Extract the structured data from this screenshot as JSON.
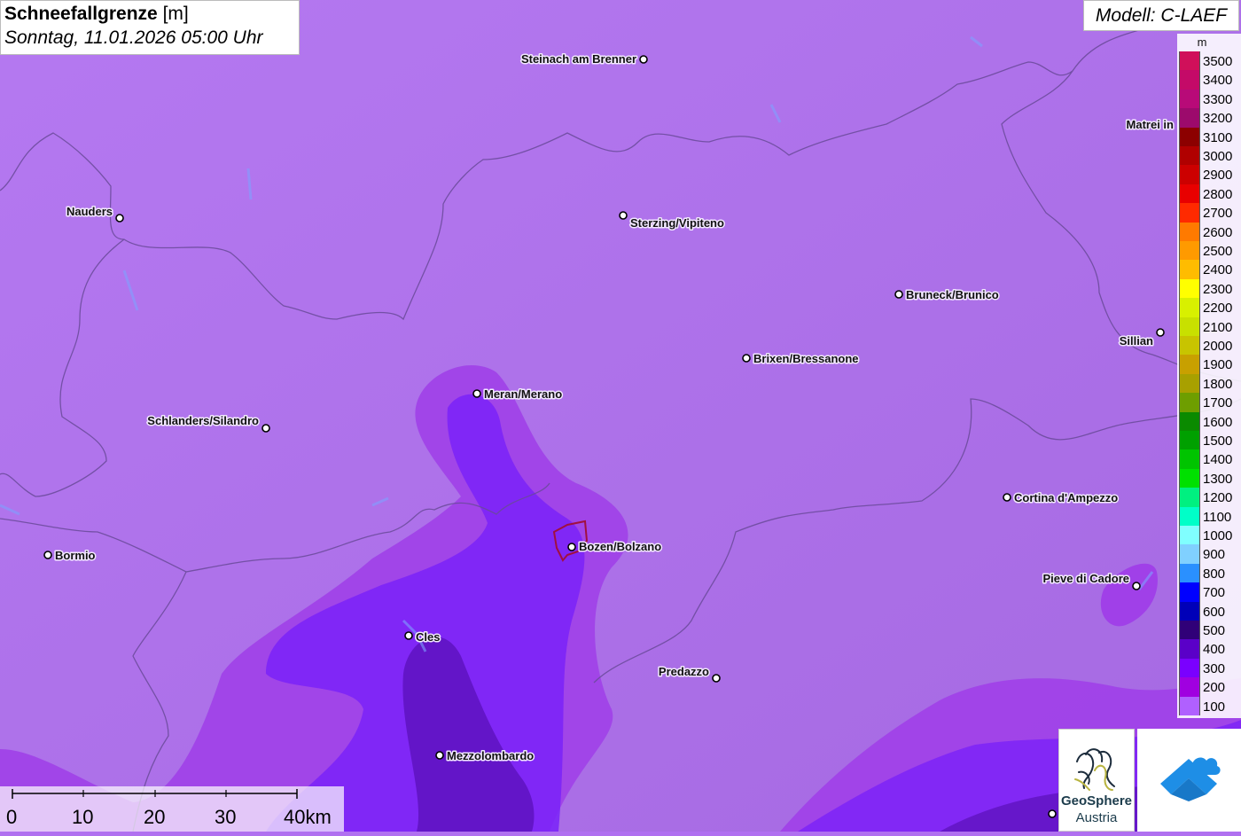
{
  "title": {
    "main": "Schneefallgrenze",
    "unit": "[m]",
    "datetime": "Sonntag, 11.01.2026 05:00 Uhr"
  },
  "model": "Modell: C-LAEF",
  "legend": {
    "unit": "m",
    "entries": [
      {
        "value": "3500",
        "color": "#d0105a"
      },
      {
        "value": "3400",
        "color": "#c40a68"
      },
      {
        "value": "3300",
        "color": "#b80a78"
      },
      {
        "value": "3200",
        "color": "#9c0a6c"
      },
      {
        "value": "3100",
        "color": "#8c0000"
      },
      {
        "value": "3000",
        "color": "#b00000"
      },
      {
        "value": "2900",
        "color": "#cc0000"
      },
      {
        "value": "2800",
        "color": "#e80000"
      },
      {
        "value": "2700",
        "color": "#ff2a00"
      },
      {
        "value": "2600",
        "color": "#ff7a00"
      },
      {
        "value": "2500",
        "color": "#ff9a00"
      },
      {
        "value": "2400",
        "color": "#ffbc00"
      },
      {
        "value": "2300",
        "color": "#ffff00"
      },
      {
        "value": "2200",
        "color": "#d8f000"
      },
      {
        "value": "2100",
        "color": "#c8e000"
      },
      {
        "value": "2000",
        "color": "#c8c400"
      },
      {
        "value": "1900",
        "color": "#c8a000"
      },
      {
        "value": "1800",
        "color": "#a8a000"
      },
      {
        "value": "1700",
        "color": "#6e9e00"
      },
      {
        "value": "1600",
        "color": "#0a8a00"
      },
      {
        "value": "1500",
        "color": "#00a000"
      },
      {
        "value": "1400",
        "color": "#00c400"
      },
      {
        "value": "1300",
        "color": "#00e000"
      },
      {
        "value": "1200",
        "color": "#00f080"
      },
      {
        "value": "1100",
        "color": "#00ffc8"
      },
      {
        "value": "1000",
        "color": "#80ffff"
      },
      {
        "value": "900",
        "color": "#80d0ff"
      },
      {
        "value": "800",
        "color": "#2a90ff"
      },
      {
        "value": "700",
        "color": "#0000ff"
      },
      {
        "value": "600",
        "color": "#0000b8"
      },
      {
        "value": "500",
        "color": "#300078"
      },
      {
        "value": "400",
        "color": "#5a00c8"
      },
      {
        "value": "300",
        "color": "#7a00ff"
      },
      {
        "value": "200",
        "color": "#a000e0"
      },
      {
        "value": "100",
        "color": "#b060ff"
      }
    ]
  },
  "cities": [
    {
      "name": "Steinach am Brenner"
    },
    {
      "name": "Nauders"
    },
    {
      "name": "Sterzing/Vipiteno"
    },
    {
      "name": "Bruneck/Brunico"
    },
    {
      "name": "Matrei in"
    },
    {
      "name": "Sillian"
    },
    {
      "name": "Brixen/Bressanone"
    },
    {
      "name": "Meran/Merano"
    },
    {
      "name": "Schlanders/Silandro"
    },
    {
      "name": "Cortina d'Ampezzo"
    },
    {
      "name": "Bormio"
    },
    {
      "name": "Bozen/Bolzano"
    },
    {
      "name": "Pieve di Cadore"
    },
    {
      "name": "Cles"
    },
    {
      "name": "Predazzo"
    },
    {
      "name": "Mezzolombardo"
    }
  ],
  "scalebar": {
    "labels": [
      "0",
      "10",
      "20",
      "30",
      "40km"
    ]
  },
  "logos": {
    "geosphere_line1": "GeoSphere",
    "geosphere_line2": "Austria"
  },
  "colors": {
    "base_100": "#b070f0",
    "zone_200": "#a040e8",
    "zone_300": "#7a20ff",
    "zone_400": "#5a10b0",
    "border": "#6a4a9a"
  }
}
